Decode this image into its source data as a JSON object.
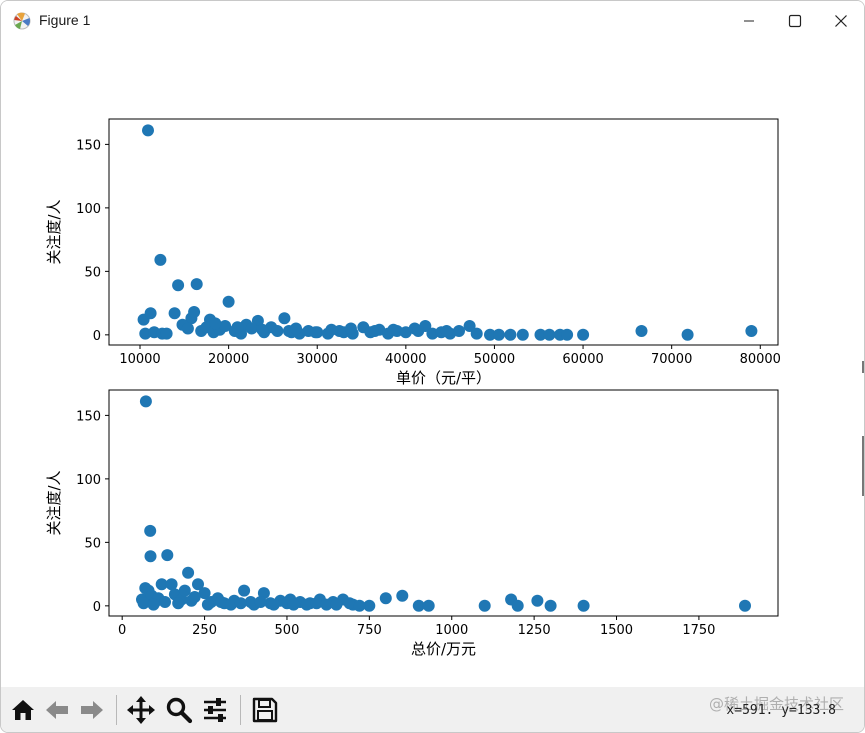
{
  "window": {
    "title": "Figure 1",
    "minimize_icon": "minimize-icon",
    "maximize_icon": "maximize-icon",
    "close_icon": "close-icon"
  },
  "toolbar": {
    "buttons": [
      {
        "name": "home-icon"
      },
      {
        "name": "back-arrow-icon"
      },
      {
        "name": "forward-arrow-icon"
      },
      {
        "name": "pan-icon"
      },
      {
        "name": "zoom-icon"
      },
      {
        "name": "configure-subplots-icon"
      },
      {
        "name": "save-icon"
      }
    ],
    "coords": "x=591. y=133.8",
    "watermark": "@稀土掘金技术社区"
  },
  "colors": {
    "marker": "#1f77b4"
  },
  "chart_data": [
    {
      "type": "scatter",
      "xlabel": "单价（元/平）",
      "ylabel": "关注度/人",
      "xlim": [
        6500,
        82000
      ],
      "ylim": [
        -8,
        170
      ],
      "xticks": [
        "10000",
        "20000",
        "30000",
        "40000",
        "50000",
        "60000",
        "70000",
        "80000"
      ],
      "xtick_values": [
        10000,
        20000,
        30000,
        40000,
        50000,
        60000,
        70000,
        80000
      ],
      "yticks": [
        "0",
        "50",
        "100",
        "150"
      ],
      "ytick_values": [
        0,
        50,
        100,
        150
      ],
      "points": [
        [
          10900,
          161
        ],
        [
          12300,
          59
        ],
        [
          14300,
          39
        ],
        [
          16400,
          40
        ],
        [
          20000,
          26
        ],
        [
          10400,
          12
        ],
        [
          11200,
          17
        ],
        [
          13900,
          17
        ],
        [
          15800,
          13
        ],
        [
          16100,
          18
        ],
        [
          26300,
          13
        ],
        [
          23300,
          11
        ],
        [
          17900,
          12
        ],
        [
          22000,
          8
        ],
        [
          10600,
          1
        ],
        [
          11600,
          2
        ],
        [
          12500,
          1
        ],
        [
          14800,
          8
        ],
        [
          15400,
          5
        ],
        [
          16900,
          3
        ],
        [
          17500,
          6
        ],
        [
          18300,
          2
        ],
        [
          19000,
          4
        ],
        [
          19600,
          7
        ],
        [
          20700,
          3
        ],
        [
          21400,
          1
        ],
        [
          22600,
          5
        ],
        [
          24000,
          2
        ],
        [
          24800,
          6
        ],
        [
          25500,
          3
        ],
        [
          27100,
          2
        ],
        [
          28000,
          1
        ],
        [
          29000,
          3
        ],
        [
          30000,
          2
        ],
        [
          31200,
          1
        ],
        [
          32500,
          3
        ],
        [
          33000,
          2
        ],
        [
          34000,
          1
        ],
        [
          35200,
          6
        ],
        [
          36000,
          2
        ],
        [
          37000,
          4
        ],
        [
          38000,
          1
        ],
        [
          39000,
          3
        ],
        [
          40000,
          2
        ],
        [
          41000,
          5
        ],
        [
          42200,
          7
        ],
        [
          43000,
          1
        ],
        [
          44000,
          2
        ],
        [
          45000,
          1
        ],
        [
          46000,
          3
        ],
        [
          47200,
          7
        ],
        [
          48000,
          1
        ],
        [
          49500,
          0
        ],
        [
          50500,
          0
        ],
        [
          51800,
          0
        ],
        [
          53200,
          0
        ],
        [
          55200,
          0
        ],
        [
          56200,
          0
        ],
        [
          57400,
          0
        ],
        [
          58200,
          0
        ],
        [
          60000,
          0
        ],
        [
          66600,
          3
        ],
        [
          71800,
          0
        ],
        [
          79000,
          3
        ],
        [
          13000,
          1
        ],
        [
          18500,
          9
        ],
        [
          21000,
          6
        ],
        [
          23800,
          4
        ],
        [
          26800,
          3
        ],
        [
          27600,
          5
        ],
        [
          29800,
          2
        ],
        [
          31600,
          4
        ],
        [
          33800,
          5
        ],
        [
          36500,
          3
        ],
        [
          38600,
          4
        ],
        [
          41400,
          3
        ],
        [
          44600,
          3
        ]
      ]
    },
    {
      "type": "scatter",
      "xlabel": "总价/万元",
      "ylabel": "关注度/人",
      "xlim": [
        -40,
        1990
      ],
      "ylim": [
        -8,
        170
      ],
      "xticks": [
        "0",
        "250",
        "500",
        "750",
        "1000",
        "1250",
        "1500",
        "1750"
      ],
      "xtick_values": [
        0,
        250,
        500,
        750,
        1000,
        1250,
        1500,
        1750
      ],
      "yticks": [
        "0",
        "50",
        "100",
        "150"
      ],
      "ytick_values": [
        0,
        50,
        100,
        150
      ],
      "points": [
        [
          72,
          161
        ],
        [
          85,
          59
        ],
        [
          86,
          39
        ],
        [
          137,
          40
        ],
        [
          200,
          26
        ],
        [
          60,
          5
        ],
        [
          70,
          14
        ],
        [
          80,
          12
        ],
        [
          90,
          8
        ],
        [
          100,
          3
        ],
        [
          110,
          6
        ],
        [
          120,
          17
        ],
        [
          150,
          17
        ],
        [
          160,
          9
        ],
        [
          180,
          5
        ],
        [
          190,
          12
        ],
        [
          210,
          4
        ],
        [
          230,
          17
        ],
        [
          250,
          10
        ],
        [
          270,
          3
        ],
        [
          290,
          6
        ],
        [
          310,
          2
        ],
        [
          340,
          4
        ],
        [
          370,
          12
        ],
        [
          390,
          3
        ],
        [
          430,
          10
        ],
        [
          450,
          2
        ],
        [
          480,
          4
        ],
        [
          510,
          5
        ],
        [
          540,
          3
        ],
        [
          570,
          2
        ],
        [
          600,
          5
        ],
        [
          640,
          3
        ],
        [
          670,
          5
        ],
        [
          700,
          1
        ],
        [
          750,
          0
        ],
        [
          800,
          6
        ],
        [
          850,
          8
        ],
        [
          900,
          0
        ],
        [
          930,
          0
        ],
        [
          1100,
          0
        ],
        [
          1180,
          5
        ],
        [
          1200,
          0
        ],
        [
          1260,
          4
        ],
        [
          1300,
          0
        ],
        [
          1400,
          0
        ],
        [
          1890,
          0
        ],
        [
          65,
          2
        ],
        [
          95,
          1
        ],
        [
          130,
          3
        ],
        [
          170,
          2
        ],
        [
          220,
          7
        ],
        [
          260,
          1
        ],
        [
          300,
          3
        ],
        [
          330,
          1
        ],
        [
          360,
          2
        ],
        [
          400,
          1
        ],
        [
          420,
          3
        ],
        [
          460,
          1
        ],
        [
          500,
          2
        ],
        [
          520,
          1
        ],
        [
          560,
          1
        ],
        [
          590,
          2
        ],
        [
          620,
          1
        ],
        [
          650,
          1
        ],
        [
          690,
          2
        ],
        [
          720,
          0
        ]
      ]
    }
  ]
}
